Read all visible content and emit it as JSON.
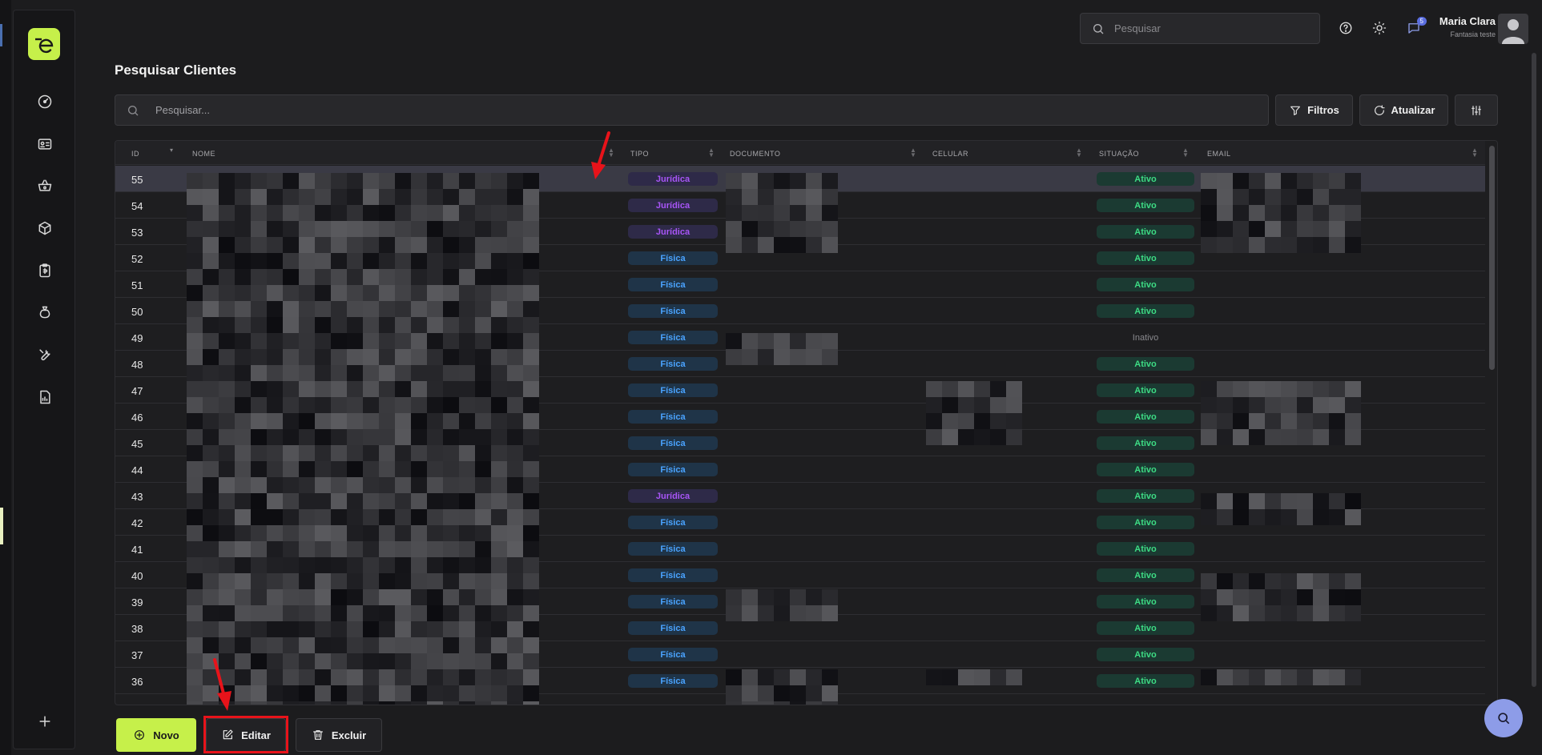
{
  "header": {
    "search_placeholder": "Pesquisar",
    "notification_count": "5",
    "user_name": "Maria Clara",
    "user_company": "Fantasia teste"
  },
  "page": {
    "title": "Pesquisar Clientes",
    "search_placeholder": "Pesquisar...",
    "filters_label": "Filtros",
    "refresh_label": "Atualizar"
  },
  "table": {
    "columns": [
      "ID",
      "NOME",
      "TIPO",
      "DOCUMENTO",
      "CELULAR",
      "SITUAÇÃO",
      "EMAIL"
    ],
    "rows": [
      {
        "id": "55",
        "tipo": "Jurídica",
        "situacao": "Ativo"
      },
      {
        "id": "54",
        "tipo": "Jurídica",
        "situacao": "Ativo"
      },
      {
        "id": "53",
        "tipo": "Jurídica",
        "situacao": "Ativo"
      },
      {
        "id": "52",
        "tipo": "Física",
        "situacao": "Ativo"
      },
      {
        "id": "51",
        "tipo": "Física",
        "situacao": "Ativo"
      },
      {
        "id": "50",
        "tipo": "Física",
        "situacao": "Ativo"
      },
      {
        "id": "49",
        "tipo": "Física",
        "situacao": "Inativo"
      },
      {
        "id": "48",
        "tipo": "Física",
        "situacao": "Ativo"
      },
      {
        "id": "47",
        "tipo": "Física",
        "situacao": "Ativo"
      },
      {
        "id": "46",
        "tipo": "Física",
        "situacao": "Ativo"
      },
      {
        "id": "45",
        "tipo": "Física",
        "situacao": "Ativo"
      },
      {
        "id": "44",
        "tipo": "Física",
        "situacao": "Ativo"
      },
      {
        "id": "43",
        "tipo": "Jurídica",
        "situacao": "Ativo"
      },
      {
        "id": "42",
        "tipo": "Física",
        "situacao": "Ativo"
      },
      {
        "id": "41",
        "tipo": "Física",
        "situacao": "Ativo"
      },
      {
        "id": "40",
        "tipo": "Física",
        "situacao": "Ativo"
      },
      {
        "id": "39",
        "tipo": "Física",
        "situacao": "Ativo"
      },
      {
        "id": "38",
        "tipo": "Física",
        "situacao": "Ativo"
      },
      {
        "id": "37",
        "tipo": "Física",
        "situacao": "Ativo"
      },
      {
        "id": "36",
        "tipo": "Física",
        "situacao": "Ativo"
      }
    ]
  },
  "actions": {
    "new_label": "Novo",
    "edit_label": "Editar",
    "delete_label": "Excluir"
  },
  "sidebar": {
    "icons": [
      "dashboard-icon",
      "id-card-icon",
      "basket-icon",
      "box-icon",
      "clipboard-icon",
      "money-bag-icon",
      "tools-icon",
      "report-icon",
      "plus-icon"
    ]
  },
  "colors": {
    "accent": "#c6f04a",
    "juridica": "#a855f7",
    "fisica": "#4aa3ff",
    "ativo": "#3ddc84",
    "highlight": "#e8131a"
  }
}
